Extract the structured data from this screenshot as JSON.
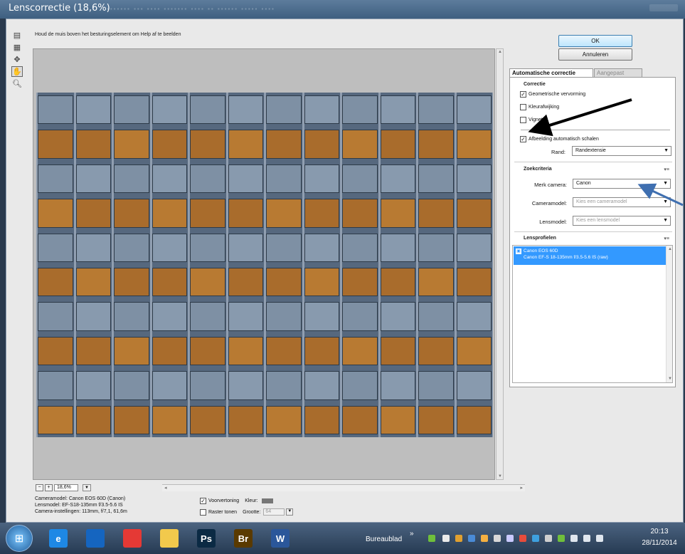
{
  "window": {
    "title": "Lenscorrectie (18,6%)"
  },
  "toolbar": {
    "tools": [
      {
        "icon": "lens-correction-tool-icon"
      },
      {
        "icon": "grid-tool-icon"
      },
      {
        "icon": "move-grid-tool-icon"
      },
      {
        "icon": "hand-tool-icon"
      },
      {
        "icon": "zoom-tool-icon"
      }
    ]
  },
  "help_text": "Houd de muis boven het besturingselement om Help af te beelden",
  "zoom": {
    "value": "18,6%"
  },
  "metadata": {
    "cameramodel": "Cameramodel: Canon EOS 60D (Canon)",
    "lensmodel": "Lensmodel: EF-S18-135mm f/3.5-5.6 IS",
    "camera_settings": "Camera-instellingen: 113mm, f/7,1, 61,6m"
  },
  "preview": {
    "voorvertoning_label": "Voorvertoning",
    "voorvertoning_checked": true,
    "kleur_label": "Kleur:",
    "raster_label": "Raster tonen",
    "raster_checked": false,
    "grootte_label": "Grootte:",
    "grootte_value": "64"
  },
  "buttons": {
    "ok": "OK",
    "cancel": "Annuleren"
  },
  "tabs": [
    {
      "label": "Automatische correctie",
      "active": true
    },
    {
      "label": "Aangepast",
      "active": false
    }
  ],
  "correctie": {
    "header": "Correctie",
    "geometrisch": {
      "label": "Geometrische vervorming",
      "checked": true
    },
    "kleurafwijking": {
      "label": "Kleurafwijking",
      "checked": false
    },
    "vignet": {
      "label": "Vignet",
      "checked": false
    },
    "auto_schalen": {
      "label": "Afbeelding automatisch schalen",
      "checked": true
    },
    "rand_label": "Rand:",
    "rand_value": "Randextensie"
  },
  "zoekcriteria": {
    "header": "Zoekcriteria",
    "merk_label": "Merk camera:",
    "merk_value": "Canon",
    "cameramodel_label": "Cameramodel:",
    "cameramodel_placeholder": "Kies een cameramodel",
    "lensmodel_label": "Lensmodel:",
    "lensmodel_placeholder": "Kies een lensmodel"
  },
  "lensprofielen": {
    "header": "Lensprofielen",
    "items": [
      {
        "line1": "Canon EOS 60D",
        "line2": "Canon EF-S 18-135mm f/3.5-5.6 IS (raw)"
      }
    ]
  },
  "taskbar": {
    "apps": [
      {
        "icon": "internet-explorer-icon",
        "label": "e",
        "color": "#1e88e5"
      },
      {
        "icon": "media-center-icon",
        "label": "",
        "color": "#1565c0"
      },
      {
        "icon": "chrome-icon",
        "label": "",
        "color": "#e53935"
      },
      {
        "icon": "folder-icon",
        "label": "",
        "color": "#f2c94c"
      },
      {
        "icon": "photoshop-icon",
        "label": "Ps",
        "color": "#0b2a44"
      },
      {
        "icon": "bridge-icon",
        "label": "Br",
        "color": "#5a3a00"
      },
      {
        "icon": "word-icon",
        "label": "W",
        "color": "#2b579a"
      }
    ],
    "bureaublad": "Bureaublad",
    "time": "20:13",
    "date": "28/11/2014"
  }
}
